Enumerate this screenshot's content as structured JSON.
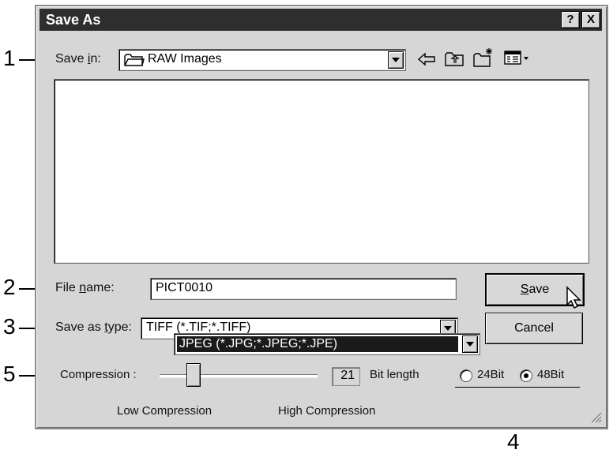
{
  "dialog": {
    "title": "Save As",
    "help_button": "?",
    "close_button": "X"
  },
  "save_in": {
    "label_pre": "Save ",
    "label_key": "i",
    "label_post": "n:",
    "value": "RAW Images"
  },
  "file_name": {
    "label_pre": "File ",
    "label_key": "n",
    "label_post": "ame:",
    "value": "PICT0010"
  },
  "save_as_type": {
    "label_pre": "Save as ",
    "label_key": "t",
    "label_post": "ype:",
    "value": "TIFF (*.TIF;*.TIFF)",
    "dropdown_selected": "JPEG (*.JPG;*.JPEG;*.JPE)"
  },
  "buttons": {
    "save_key": "S",
    "save_rest": "ave",
    "cancel": "Cancel"
  },
  "compression": {
    "label": "Compression :",
    "value": "21",
    "level": 0.27,
    "low": "Low Compression",
    "high": "High Compression"
  },
  "bit_length": {
    "label": "Bit length",
    "option_24": "24Bit",
    "option_48": "48Bit",
    "selected": "48Bit"
  },
  "callouts": [
    "1",
    "2",
    "3",
    "4",
    "5"
  ]
}
